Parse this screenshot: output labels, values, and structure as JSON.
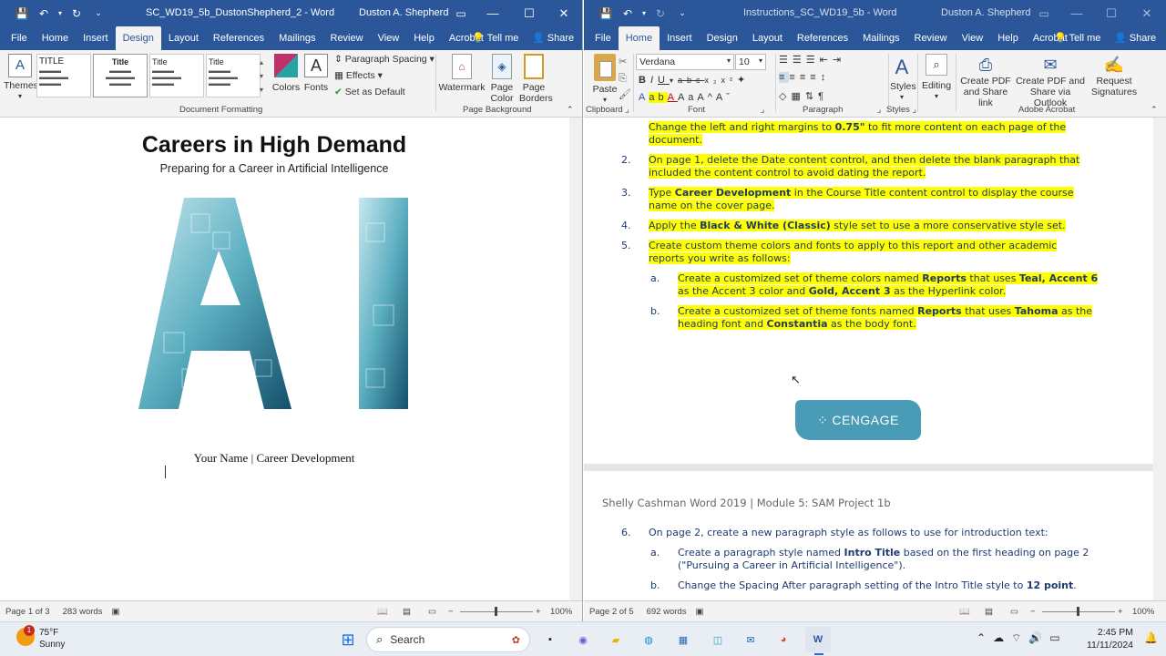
{
  "left_window": {
    "title": "SC_WD19_5b_DustonShepherd_2  -  Word",
    "user": "Duston A. Shepherd",
    "tabs": [
      "File",
      "Home",
      "Insert",
      "Design",
      "Layout",
      "References",
      "Mailings",
      "Review",
      "View",
      "Help",
      "Acrobat"
    ],
    "active_tab": "Design",
    "tell_me": "Tell me",
    "share": "Share",
    "ribbon": {
      "themes": "Themes",
      "styles_gallery": [
        "TITLE",
        "Title",
        "Title",
        "Title"
      ],
      "colors": "Colors",
      "fonts": "Fonts",
      "paragraph_spacing": "Paragraph Spacing",
      "effects": "Effects",
      "set_as_default": "Set as Default",
      "watermark": "Watermark",
      "page_color": "Page Color",
      "page_borders": "Page Borders",
      "group_document_formatting": "Document Formatting",
      "group_page_background": "Page Background"
    },
    "document": {
      "title": "Careers in High Demand",
      "subtitle": "Preparing for a Career in Artificial Intelligence",
      "cover_image_letters": "AI",
      "footer_name": "Your Name",
      "footer_separator": "|",
      "footer_course": "Career Development"
    },
    "status": {
      "page": "Page 1 of 3",
      "words": "283 words",
      "zoom": "100%"
    }
  },
  "right_window": {
    "title": "Instructions_SC_WD19_5b  -  Word",
    "user": "Duston A. Shepherd",
    "tabs": [
      "File",
      "Home",
      "Insert",
      "Design",
      "Layout",
      "References",
      "Mailings",
      "Review",
      "View",
      "Help",
      "Acrobat"
    ],
    "active_tab": "Home",
    "tell_me": "Tell me",
    "share": "Share",
    "ribbon": {
      "paste": "Paste",
      "font_name": "Verdana",
      "font_size": "10",
      "styles": "Styles",
      "editing": "Editing",
      "create_pdf_share_link": "Create PDF and Share link",
      "create_pdf_outlook": "Create PDF and Share via Outlook",
      "request_signatures": "Request Signatures",
      "group_clipboard": "Clipboard",
      "group_font": "Font",
      "group_paragraph": "Paragraph",
      "group_styles": "Styles",
      "group_adobe": "Adobe Acrobat"
    },
    "instructions": {
      "item1_tail": {
        "a": "Change the left and right margins to ",
        "b": "0.75\"",
        "c": " to fit more content on each page of the document."
      },
      "item2": {
        "num": "2.",
        "text": "On page 1, delete the Date content control, and then delete the blank paragraph that included the content control to avoid dating the report."
      },
      "item3": {
        "num": "3.",
        "a": "Type ",
        "b": "Career Development",
        "c": " in the Course Title content control to display the course name on the cover page."
      },
      "item4": {
        "num": "4.",
        "a": "Apply the ",
        "b": "Black & White (Classic)",
        "c": " style set to use a more conservative style set."
      },
      "item5": {
        "num": "5.",
        "text": "Create custom theme colors and fonts to apply to this report and other academic reports you write as follows:"
      },
      "item5a": {
        "num": "a.",
        "a": "Create a customized set of theme colors named ",
        "b": "Reports",
        "c": " that uses ",
        "d": "Teal, Accent 6",
        "e": " as the Accent 3 color and ",
        "f": "Gold, Accent 3",
        "g": " as the Hyperlink color."
      },
      "item5b": {
        "num": "b.",
        "a": "Create a customized set of theme fonts named ",
        "b": "Reports",
        "c": " that uses ",
        "d": "Tahoma",
        "e": " as the heading font and ",
        "f": "Constantia",
        "g": " as the body font."
      },
      "logo": "CENGAGE",
      "page2_header": "Shelly Cashman Word 2019 | Module 5: SAM Project 1b",
      "item6": {
        "num": "6.",
        "text": "On page 2, create a new paragraph style as follows to use for introduction text:"
      },
      "item6a": {
        "num": "a.",
        "a": "Create a paragraph style named ",
        "b": "Intro Title",
        "c": " based on the first heading on page 2 (\"Pursuing a Career in Artificial Intelligence\")."
      },
      "item6b": {
        "num": "b.",
        "a": "Change the Spacing After paragraph setting of the Intro Title style to ",
        "b": "12 point",
        "c": "."
      }
    },
    "status": {
      "page": "Page 2 of 5",
      "words": "692 words",
      "zoom": "100%"
    }
  },
  "taskbar": {
    "weather_temp": "75°F",
    "weather_desc": "Sunny",
    "weather_badge": "1",
    "search": "Search",
    "time": "2:45 PM",
    "date": "11/11/2024"
  },
  "colors": {
    "word_blue": "#2b579a",
    "highlight": "#ffff00",
    "instruction_text": "#1e3a6e",
    "cover_teal": "#2a7f93"
  }
}
